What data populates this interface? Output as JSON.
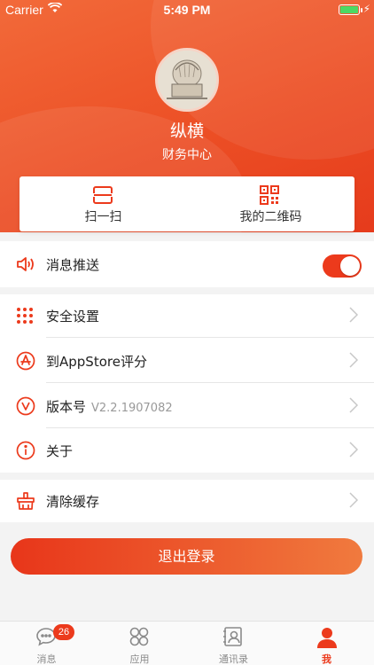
{
  "status_bar": {
    "carrier": "Carrier",
    "time": "5:49 PM"
  },
  "profile": {
    "name": "纵横",
    "department": "财务中心"
  },
  "quick_actions": [
    {
      "label": "扫一扫",
      "icon": "scan-icon"
    },
    {
      "label": "我的二维码",
      "icon": "qrcode-icon"
    }
  ],
  "settings": {
    "push": {
      "label": "消息推送",
      "enabled": true
    },
    "security": {
      "label": "安全设置"
    },
    "rate": {
      "label": "到AppStore评分"
    },
    "version": {
      "label": "版本号",
      "value": "V2.2.1907082"
    },
    "about": {
      "label": "关于"
    },
    "clear_cache": {
      "label": "清除缓存"
    }
  },
  "logout_label": "退出登录",
  "tabbar": {
    "tabs": [
      {
        "label": "消息",
        "icon": "chat-bubble-icon",
        "badge": "26"
      },
      {
        "label": "应用",
        "icon": "apps-icon"
      },
      {
        "label": "通讯录",
        "icon": "contacts-icon"
      },
      {
        "label": "我",
        "icon": "person-icon",
        "active": true
      }
    ]
  },
  "colors": {
    "accent": "#ec3a1c",
    "accent_light": "#f07a3e"
  }
}
